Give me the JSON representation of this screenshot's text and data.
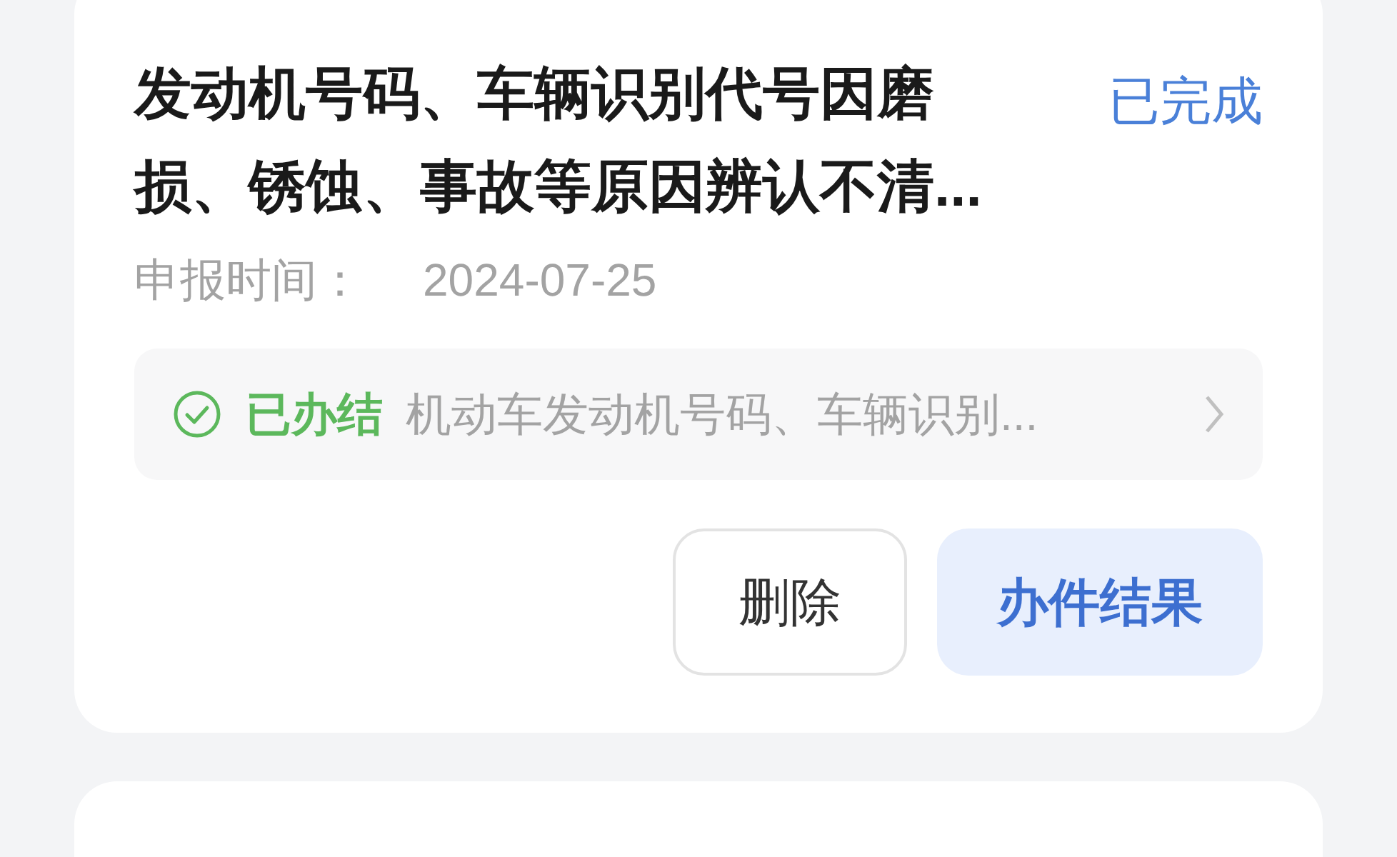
{
  "cards": [
    {
      "title": "发动机号码、车辆识别代号因磨损、锈蚀、事故等原因辨认不清...",
      "status": "已完成",
      "date_label": "申报时间：",
      "date": "2024-07-25",
      "progress": {
        "state": "已办结",
        "done": true,
        "detail": "机动车发动机号码、车辆识别..."
      },
      "buttons": [
        {
          "label": "删除",
          "kind": "secondary"
        },
        {
          "label": "办件结果",
          "kind": "primary"
        }
      ]
    }
  ]
}
